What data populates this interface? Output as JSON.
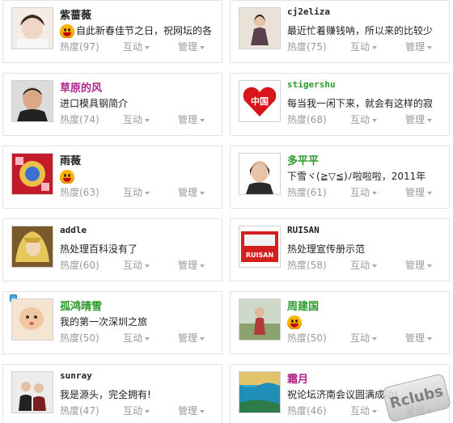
{
  "labels": {
    "interact": "互动",
    "manage": "管理"
  },
  "cards": [
    {
      "name": "紫蔷薇",
      "status": "自此新春佳节之日，祝网坛的各",
      "heat": "热度(97)",
      "has_emoji": true
    },
    {
      "name": "cj2eliza",
      "status": "最近忙着赚钱呐，所以来的比较少",
      "heat": "热度(75)"
    },
    {
      "name": "草原的风",
      "status": "进口模具钢简介",
      "heat": "热度(74)"
    },
    {
      "name": "stigershu",
      "status": "每当我一闲下来，就会有这样的寂",
      "heat": "热度(68)"
    },
    {
      "name": "雨薇",
      "status": "",
      "heat": "热度(63)",
      "has_emoji": true
    },
    {
      "name": "多平平",
      "status": "下雪ヾ(≧▽≦)ﾉ啦啦啦，2011年",
      "heat": "热度(61)"
    },
    {
      "name": "addle",
      "status": "热处理百科没有了",
      "heat": "热度(60)"
    },
    {
      "name": "RUISAN",
      "status": "热处理宣传册示范",
      "heat": "热度(58)",
      "logo_text": "RUISAN"
    },
    {
      "name": "孤鸿晴雪",
      "status": "我的第一次深圳之旅",
      "heat": "热度(50)"
    },
    {
      "name": "周建国",
      "status": "",
      "heat": "热度(50)",
      "has_emoji": true
    },
    {
      "name": "sunray",
      "status": "我是源头，完全拥有!",
      "heat": "热度(47)"
    },
    {
      "name": "霜月",
      "status": "祝论坛济南会议圆满成功!",
      "heat": "热度(46)"
    }
  ],
  "heart_text": "中国",
  "watermark": "Rclubs",
  "colors": {
    "green_name": "#2a9a2a",
    "purple_name": "#b0228c",
    "meta_gray": "#999999"
  }
}
